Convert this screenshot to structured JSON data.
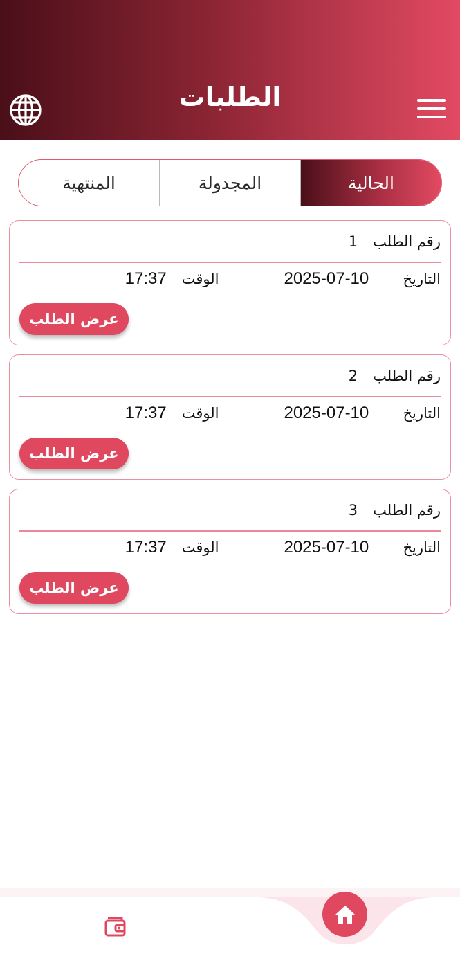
{
  "header": {
    "title": "الطلبات",
    "language_icon": "globe-icon",
    "menu_icon": "hamburger-menu-icon"
  },
  "tabs": [
    {
      "label": "المنتهية",
      "active": false
    },
    {
      "label": "المجدولة",
      "active": false
    },
    {
      "label": "الحالية",
      "active": true
    }
  ],
  "orders": [
    {
      "number_label": "رقم الطلب",
      "number": "1",
      "date_label": "التاريخ",
      "date": "2025-07-10",
      "time_label": "الوقت",
      "time": "17:37",
      "view_label": "عرض الطلب"
    },
    {
      "number_label": "رقم الطلب",
      "number": "2",
      "date_label": "التاريخ",
      "date": "2025-07-10",
      "time_label": "الوقت",
      "time": "17:37",
      "view_label": "عرض الطلب"
    },
    {
      "number_label": "رقم الطلب",
      "number": "3",
      "date_label": "التاريخ",
      "date": "2025-07-10",
      "time_label": "الوقت",
      "time": "17:37",
      "view_label": "عرض الطلب"
    }
  ],
  "bottom_nav": {
    "wallet_icon": "wallet-icon",
    "home_icon": "home-icon"
  },
  "colors": {
    "accent": "#e0485f",
    "header_dark": "#4a0f19",
    "header_light": "#e24a62",
    "card_border": "#ea8fa0"
  }
}
